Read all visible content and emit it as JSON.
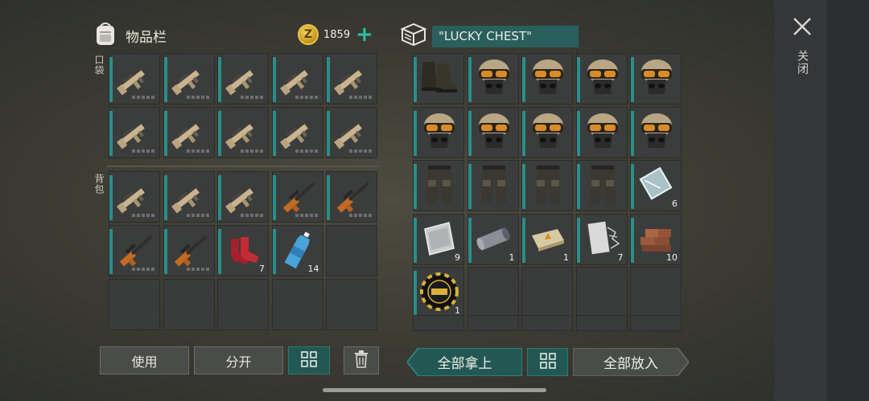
{
  "inventory": {
    "title": "物品栏",
    "coins": "1859",
    "coin_symbol": "Z",
    "pocket_label": "口袋",
    "backpack_label": "背包",
    "pocket_slots": [
      {
        "item": "rifle",
        "count": ""
      },
      {
        "item": "rifle",
        "count": ""
      },
      {
        "item": "rifle",
        "count": ""
      },
      {
        "item": "rifle",
        "count": ""
      },
      {
        "item": "rifle",
        "count": ""
      },
      {
        "item": "rifle",
        "count": ""
      },
      {
        "item": "rifle",
        "count": ""
      },
      {
        "item": "rifle",
        "count": ""
      },
      {
        "item": "rifle",
        "count": ""
      },
      {
        "item": "rifle",
        "count": ""
      }
    ],
    "backpack_slots": [
      {
        "item": "rifle",
        "count": ""
      },
      {
        "item": "rifle",
        "count": ""
      },
      {
        "item": "rifle",
        "count": ""
      },
      {
        "item": "sniper-rifle",
        "count": ""
      },
      {
        "item": "sniper-rifle",
        "count": ""
      },
      {
        "item": "sniper-rifle",
        "count": ""
      },
      {
        "item": "sniper-rifle",
        "count": ""
      },
      {
        "item": "red-socks",
        "count": "7"
      },
      {
        "item": "water-bottle",
        "count": "14"
      },
      {
        "item": "",
        "count": ""
      },
      {
        "item": "",
        "count": ""
      },
      {
        "item": "",
        "count": ""
      },
      {
        "item": "",
        "count": ""
      },
      {
        "item": "",
        "count": ""
      },
      {
        "item": "",
        "count": ""
      }
    ]
  },
  "chest": {
    "name": "\"LUCKY CHEST\"",
    "slots": [
      {
        "item": "boots",
        "count": ""
      },
      {
        "item": "helmet",
        "count": ""
      },
      {
        "item": "helmet",
        "count": ""
      },
      {
        "item": "helmet",
        "count": ""
      },
      {
        "item": "helmet",
        "count": ""
      },
      {
        "item": "helmet",
        "count": ""
      },
      {
        "item": "helmet",
        "count": ""
      },
      {
        "item": "helmet",
        "count": ""
      },
      {
        "item": "helmet",
        "count": ""
      },
      {
        "item": "helmet",
        "count": ""
      },
      {
        "item": "pants",
        "count": ""
      },
      {
        "item": "pants",
        "count": ""
      },
      {
        "item": "pants",
        "count": ""
      },
      {
        "item": "pants",
        "count": ""
      },
      {
        "item": "glass-plate",
        "count": "6"
      },
      {
        "item": "steel-sheet",
        "count": "9"
      },
      {
        "item": "fabric-roll",
        "count": "1"
      },
      {
        "item": "explosive-pack",
        "count": "1"
      },
      {
        "item": "metal-mesh",
        "count": "7"
      },
      {
        "item": "bricks",
        "count": "10"
      },
      {
        "item": "lucky-chip",
        "count": "1"
      },
      {
        "item": "",
        "count": ""
      },
      {
        "item": "",
        "count": ""
      },
      {
        "item": "",
        "count": ""
      },
      {
        "item": "",
        "count": ""
      }
    ]
  },
  "buttons": {
    "use": "使用",
    "split": "分开",
    "take_all": "全部拿上",
    "put_all": "全部放入"
  },
  "close_label": "关闭",
  "colors": {
    "accent": "#2a8e8a",
    "chest_name_bg": "#295f5c",
    "button_teal": "#235753"
  }
}
